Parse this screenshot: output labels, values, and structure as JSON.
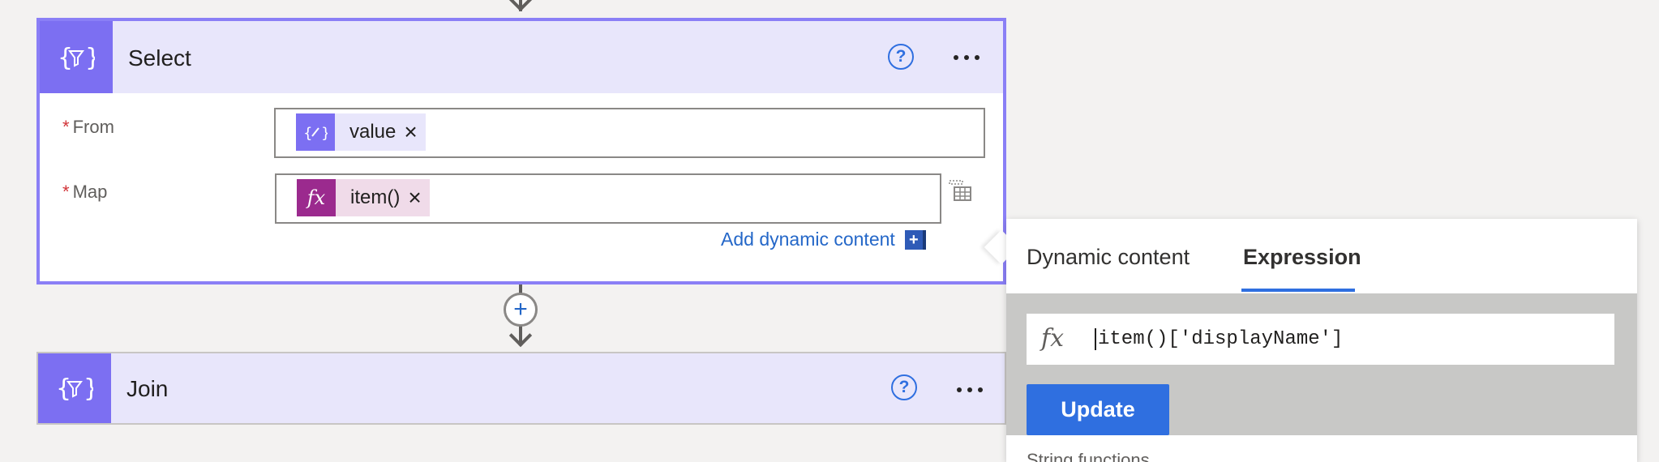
{
  "select_card": {
    "title": "Select",
    "help_label": "?",
    "from_field": {
      "label": "From",
      "required_mark": "*",
      "token_label": "value",
      "token_close": "×"
    },
    "map_field": {
      "label": "Map",
      "required_mark": "*",
      "token_label": "item()",
      "token_close": "×"
    },
    "add_dynamic_content": "Add dynamic content",
    "add_dynamic_plus": "+"
  },
  "add_step_symbol": "+",
  "join_card": {
    "title": "Join",
    "help_label": "?"
  },
  "expression_panel": {
    "tabs": [
      {
        "label": "Dynamic content"
      },
      {
        "label": "Expression"
      }
    ],
    "active_tab": "Expression",
    "fx_symbol": "fx",
    "expression_value": "item()['displayName']",
    "update_label": "Update",
    "below_text": "String functions"
  },
  "colors": {
    "accent_purple": "#7c6ff2",
    "card_border_active": "#8a7ff6",
    "header_bg": "#e8e6fb",
    "expression_token": "#9b2a8e",
    "link_blue": "#2467c8",
    "primary_button": "#2f6fe0",
    "required_red": "#d13438"
  },
  "icons": {
    "card_action": "curly-braces-filter-icon",
    "from_token": "curly-braces-pencil-icon",
    "map_token": "fx-icon",
    "map_side": "table-icon"
  }
}
